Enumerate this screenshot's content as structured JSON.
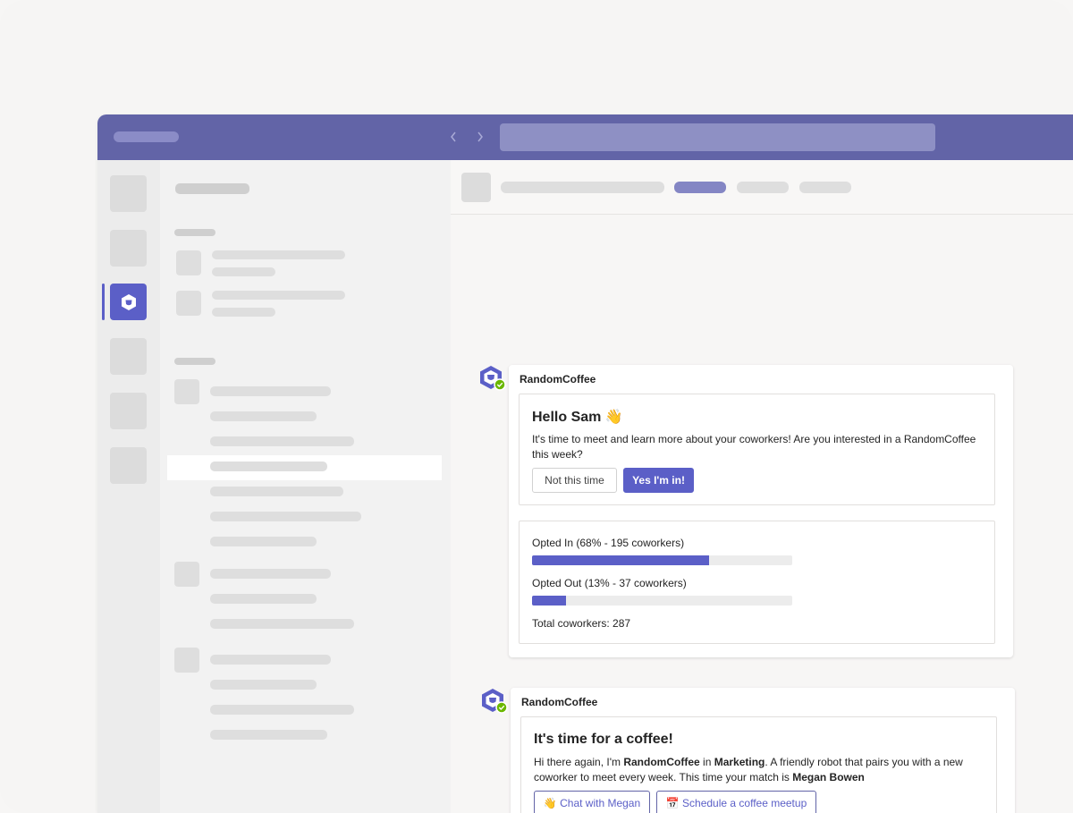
{
  "messages": [
    {
      "sender": "RandomCoffee",
      "greeting": "Hello Sam 👋",
      "body": "It's time to meet and learn more about your coworkers! Are you interested in a RandomCoffee this week?",
      "secondary_button": "Not this time",
      "primary_button": "Yes I'm in!",
      "poll": {
        "opted_in_label": "Opted In (68% - 195 coworkers)",
        "opted_in_fraction": 0.68,
        "opted_out_label": "Opted Out (13% - 37 coworkers)",
        "opted_out_fraction": 0.13,
        "total_label": "Total coworkers: 287"
      }
    },
    {
      "sender": "RandomCoffee",
      "title": "It's time for a coffee!",
      "body_1": "Hi there again, I'm ",
      "body_bot": "RandomCoffee",
      "body_2": " in ",
      "body_team": "Marketing",
      "body_3": ". A friendly robot that pairs you with a new coworker to meet every week. This time your match is ",
      "body_match": "Megan Bowen",
      "chat_button": "👋 Chat with Megan",
      "schedule_button": "📅 Schedule a coffee meetup"
    }
  ],
  "colors": {
    "brand": "#6264a7",
    "accent": "#5b5fc7",
    "status_green": "#6bb700"
  },
  "icons": {
    "back": "chevron-left-icon",
    "forward": "chevron-right-icon",
    "bot": "randomcoffee-bot-icon"
  }
}
